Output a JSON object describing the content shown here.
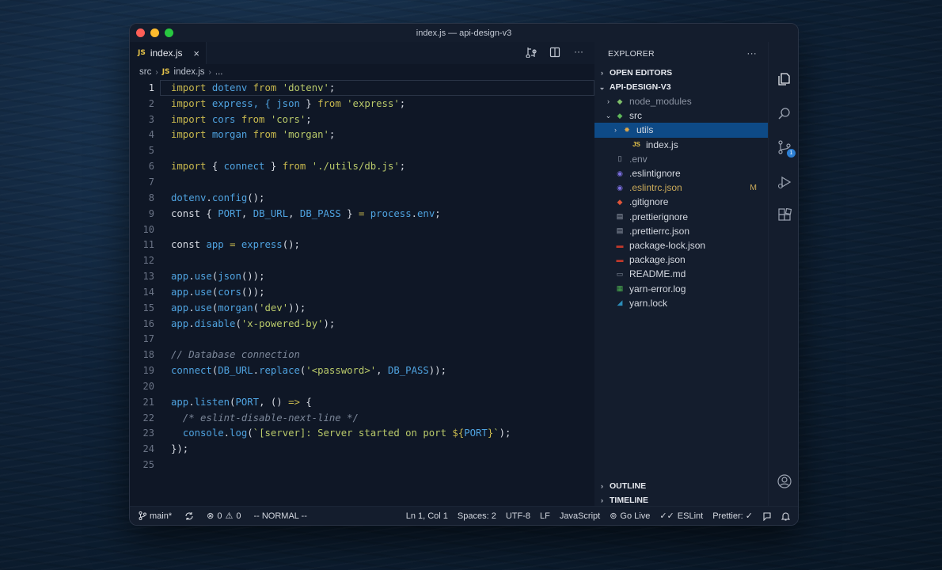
{
  "window": {
    "title": "index.js — api-design-v3"
  },
  "tab": {
    "lang_badge": "JS",
    "label": "index.js",
    "close": "×"
  },
  "breadcrumb": {
    "folder": "src",
    "lang_badge": "JS",
    "file": "index.js",
    "more": "..."
  },
  "editor": {
    "active_line": 1,
    "lines": [
      [
        {
          "t": "import",
          "c": "#c9b94e"
        },
        {
          "t": " dotenv ",
          "c": "#4fa3e0"
        },
        {
          "t": "from",
          "c": "#c9b94e"
        },
        {
          "t": " ",
          "c": "#d6dae2"
        },
        {
          "t": "'dotenv'",
          "c": "#b9c96a"
        },
        {
          "t": ";",
          "c": "#d6dae2"
        }
      ],
      [
        {
          "t": "import",
          "c": "#c9b94e"
        },
        {
          "t": " express, { ",
          "c": "#4fa3e0"
        },
        {
          "t": "json",
          "c": "#4fa3e0"
        },
        {
          "t": " } ",
          "c": "#d6dae2"
        },
        {
          "t": "from",
          "c": "#c9b94e"
        },
        {
          "t": " ",
          "c": "#d6dae2"
        },
        {
          "t": "'express'",
          "c": "#b9c96a"
        },
        {
          "t": ";",
          "c": "#d6dae2"
        }
      ],
      [
        {
          "t": "import",
          "c": "#c9b94e"
        },
        {
          "t": " cors ",
          "c": "#4fa3e0"
        },
        {
          "t": "from",
          "c": "#c9b94e"
        },
        {
          "t": " ",
          "c": "#d6dae2"
        },
        {
          "t": "'cors'",
          "c": "#b9c96a"
        },
        {
          "t": ";",
          "c": "#d6dae2"
        }
      ],
      [
        {
          "t": "import",
          "c": "#c9b94e"
        },
        {
          "t": " morgan ",
          "c": "#4fa3e0"
        },
        {
          "t": "from",
          "c": "#c9b94e"
        },
        {
          "t": " ",
          "c": "#d6dae2"
        },
        {
          "t": "'morgan'",
          "c": "#b9c96a"
        },
        {
          "t": ";",
          "c": "#d6dae2"
        }
      ],
      [],
      [
        {
          "t": "import",
          "c": "#c9b94e"
        },
        {
          "t": " { ",
          "c": "#d6dae2"
        },
        {
          "t": "connect",
          "c": "#4fa3e0"
        },
        {
          "t": " } ",
          "c": "#d6dae2"
        },
        {
          "t": "from",
          "c": "#c9b94e"
        },
        {
          "t": " ",
          "c": "#d6dae2"
        },
        {
          "t": "'./utils/db.js'",
          "c": "#b9c96a"
        },
        {
          "t": ";",
          "c": "#d6dae2"
        }
      ],
      [],
      [
        {
          "t": "dotenv",
          "c": "#4fa3e0"
        },
        {
          "t": ".",
          "c": "#d6dae2"
        },
        {
          "t": "config",
          "c": "#4fa3e0"
        },
        {
          "t": "();",
          "c": "#d6dae2"
        }
      ],
      [
        {
          "t": "const",
          "c": "#d6dae2"
        },
        {
          "t": " { ",
          "c": "#d6dae2"
        },
        {
          "t": "PORT",
          "c": "#4fa3e0"
        },
        {
          "t": ", ",
          "c": "#d6dae2"
        },
        {
          "t": "DB_URL",
          "c": "#4fa3e0"
        },
        {
          "t": ", ",
          "c": "#d6dae2"
        },
        {
          "t": "DB_PASS",
          "c": "#4fa3e0"
        },
        {
          "t": " } ",
          "c": "#d6dae2"
        },
        {
          "t": "=",
          "c": "#c9b94e"
        },
        {
          "t": " ",
          "c": "#d6dae2"
        },
        {
          "t": "process",
          "c": "#4fa3e0"
        },
        {
          "t": ".",
          "c": "#d6dae2"
        },
        {
          "t": "env",
          "c": "#4fa3e0"
        },
        {
          "t": ";",
          "c": "#d6dae2"
        }
      ],
      [],
      [
        {
          "t": "const",
          "c": "#d6dae2"
        },
        {
          "t": " ",
          "c": "#d6dae2"
        },
        {
          "t": "app",
          "c": "#4fa3e0"
        },
        {
          "t": " ",
          "c": "#d6dae2"
        },
        {
          "t": "=",
          "c": "#c9b94e"
        },
        {
          "t": " ",
          "c": "#d6dae2"
        },
        {
          "t": "express",
          "c": "#4fa3e0"
        },
        {
          "t": "();",
          "c": "#d6dae2"
        }
      ],
      [],
      [
        {
          "t": "app",
          "c": "#4fa3e0"
        },
        {
          "t": ".",
          "c": "#d6dae2"
        },
        {
          "t": "use",
          "c": "#4fa3e0"
        },
        {
          "t": "(",
          "c": "#d6dae2"
        },
        {
          "t": "json",
          "c": "#4fa3e0"
        },
        {
          "t": "());",
          "c": "#d6dae2"
        }
      ],
      [
        {
          "t": "app",
          "c": "#4fa3e0"
        },
        {
          "t": ".",
          "c": "#d6dae2"
        },
        {
          "t": "use",
          "c": "#4fa3e0"
        },
        {
          "t": "(",
          "c": "#d6dae2"
        },
        {
          "t": "cors",
          "c": "#4fa3e0"
        },
        {
          "t": "());",
          "c": "#d6dae2"
        }
      ],
      [
        {
          "t": "app",
          "c": "#4fa3e0"
        },
        {
          "t": ".",
          "c": "#d6dae2"
        },
        {
          "t": "use",
          "c": "#4fa3e0"
        },
        {
          "t": "(",
          "c": "#d6dae2"
        },
        {
          "t": "morgan",
          "c": "#4fa3e0"
        },
        {
          "t": "(",
          "c": "#d6dae2"
        },
        {
          "t": "'dev'",
          "c": "#b9c96a"
        },
        {
          "t": "));",
          "c": "#d6dae2"
        }
      ],
      [
        {
          "t": "app",
          "c": "#4fa3e0"
        },
        {
          "t": ".",
          "c": "#d6dae2"
        },
        {
          "t": "disable",
          "c": "#4fa3e0"
        },
        {
          "t": "(",
          "c": "#d6dae2"
        },
        {
          "t": "'x-powered-by'",
          "c": "#b9c96a"
        },
        {
          "t": ");",
          "c": "#d6dae2"
        }
      ],
      [],
      [
        {
          "t": "// Database connection",
          "c": "#7c8799",
          "i": true
        }
      ],
      [
        {
          "t": "connect",
          "c": "#4fa3e0"
        },
        {
          "t": "(",
          "c": "#d6dae2"
        },
        {
          "t": "DB_URL",
          "c": "#4fa3e0"
        },
        {
          "t": ".",
          "c": "#d6dae2"
        },
        {
          "t": "replace",
          "c": "#4fa3e0"
        },
        {
          "t": "(",
          "c": "#d6dae2"
        },
        {
          "t": "'<password>'",
          "c": "#b9c96a"
        },
        {
          "t": ", ",
          "c": "#d6dae2"
        },
        {
          "t": "DB_PASS",
          "c": "#4fa3e0"
        },
        {
          "t": "));",
          "c": "#d6dae2"
        }
      ],
      [],
      [
        {
          "t": "app",
          "c": "#4fa3e0"
        },
        {
          "t": ".",
          "c": "#d6dae2"
        },
        {
          "t": "listen",
          "c": "#4fa3e0"
        },
        {
          "t": "(",
          "c": "#d6dae2"
        },
        {
          "t": "PORT",
          "c": "#4fa3e0"
        },
        {
          "t": ", () ",
          "c": "#d6dae2"
        },
        {
          "t": "=>",
          "c": "#c9b94e"
        },
        {
          "t": " {",
          "c": "#d6dae2"
        }
      ],
      [
        {
          "t": "  /* eslint-disable-next-line */",
          "c": "#7c8799",
          "i": true
        }
      ],
      [
        {
          "t": "  ",
          "c": "#d6dae2"
        },
        {
          "t": "console",
          "c": "#4fa3e0"
        },
        {
          "t": ".",
          "c": "#d6dae2"
        },
        {
          "t": "log",
          "c": "#4fa3e0"
        },
        {
          "t": "(",
          "c": "#d6dae2"
        },
        {
          "t": "`[server]: Server started on port ",
          "c": "#b9c96a"
        },
        {
          "t": "${",
          "c": "#c9b94e"
        },
        {
          "t": "PORT",
          "c": "#4fa3e0"
        },
        {
          "t": "}",
          "c": "#c9b94e"
        },
        {
          "t": "`",
          "c": "#b9c96a"
        },
        {
          "t": ");",
          "c": "#d6dae2"
        }
      ],
      [
        {
          "t": "});",
          "c": "#d6dae2"
        }
      ],
      []
    ]
  },
  "explorer": {
    "header": "EXPLORER",
    "more": "···",
    "open_editors": "OPEN EDITORS",
    "project": "API-DESIGN-V3",
    "tree": [
      {
        "label": "node_modules",
        "indent": 1,
        "chevron": "›",
        "icon": "node-modules-folder-icon",
        "glyph": "◆",
        "color": "#7fbf6a",
        "dim": true
      },
      {
        "label": "src",
        "indent": 1,
        "chevron": "⌄",
        "icon": "src-folder-icon",
        "glyph": "◆",
        "color": "#5fb85a"
      },
      {
        "label": "utils",
        "indent": 2,
        "chevron": "›",
        "icon": "utils-folder-icon",
        "glyph": "✸",
        "color": "#e0a84a",
        "selected": true
      },
      {
        "label": "index.js",
        "indent": 3,
        "icon": "js-file-icon",
        "glyph": "JS",
        "color": "#e7c44a"
      },
      {
        "label": ".env",
        "indent": 1,
        "icon": "file-icon",
        "glyph": "▯",
        "color": "#9aa2b0",
        "dim": true
      },
      {
        "label": ".eslintignore",
        "indent": 1,
        "icon": "eslint-icon",
        "glyph": "◉",
        "color": "#7b6ee0"
      },
      {
        "label": ".eslintrc.json",
        "indent": 1,
        "icon": "eslint-icon",
        "glyph": "◉",
        "color": "#7b6ee0",
        "modified": true,
        "badge": "M"
      },
      {
        "label": ".gitignore",
        "indent": 1,
        "icon": "git-icon",
        "glyph": "◆",
        "color": "#e0553a"
      },
      {
        "label": ".prettierignore",
        "indent": 1,
        "icon": "prettier-icon",
        "glyph": "▤",
        "color": "#9aa2b0"
      },
      {
        "label": ".prettierrc.json",
        "indent": 1,
        "icon": "prettier-icon",
        "glyph": "▤",
        "color": "#9aa2b0"
      },
      {
        "label": "package-lock.json",
        "indent": 1,
        "icon": "npm-icon",
        "glyph": "▬",
        "color": "#c0392b"
      },
      {
        "label": "package.json",
        "indent": 1,
        "icon": "npm-icon",
        "glyph": "▬",
        "color": "#c0392b"
      },
      {
        "label": "README.md",
        "indent": 1,
        "icon": "markdown-icon",
        "glyph": "▭",
        "color": "#8a92a1"
      },
      {
        "label": "yarn-error.log",
        "indent": 1,
        "icon": "log-icon",
        "glyph": "▦",
        "color": "#4caf50"
      },
      {
        "label": "yarn.lock",
        "indent": 1,
        "icon": "yarn-icon",
        "glyph": "◢",
        "color": "#2c8ebb"
      }
    ],
    "outline": "OUTLINE",
    "timeline": "TIMELINE"
  },
  "activity": {
    "scm_badge": "1"
  },
  "status": {
    "branch": "main*",
    "errors": "0",
    "warnings": "0",
    "mode": "-- NORMAL --",
    "position": "Ln 1, Col 1",
    "spaces": "Spaces: 2",
    "encoding": "UTF-8",
    "eol": "LF",
    "language": "JavaScript",
    "golive": "Go Live",
    "eslint": "ESLint",
    "prettier": "Prettier: ✓"
  }
}
